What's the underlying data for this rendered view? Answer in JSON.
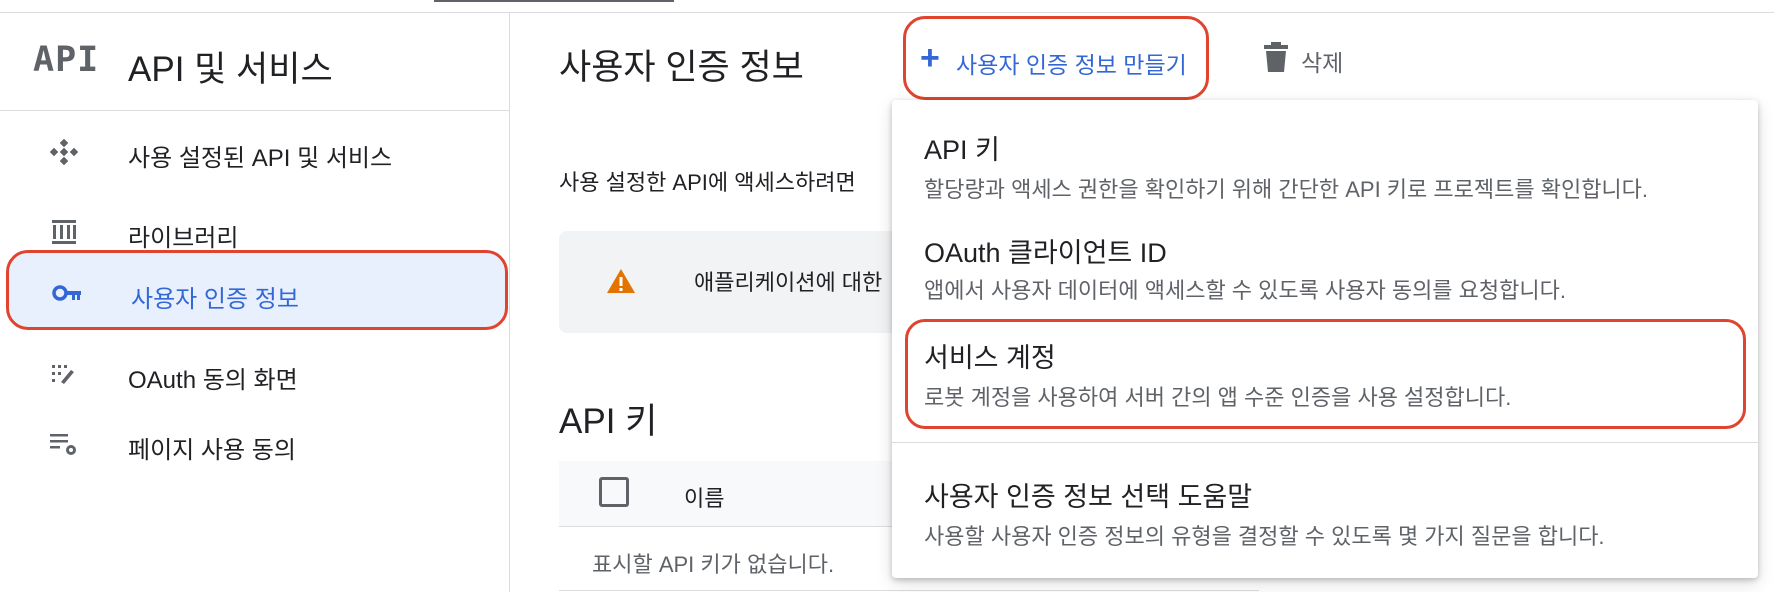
{
  "sidebar": {
    "logo": "API",
    "title": "API 및 서비스",
    "items": [
      {
        "label": "사용 설정된 API 및 서비스",
        "icon": "api-diamond-icon"
      },
      {
        "label": "라이브러리",
        "icon": "library-icon"
      },
      {
        "label": "사용자 인증 정보",
        "icon": "key-icon",
        "active": true
      },
      {
        "label": "OAuth 동의 화면",
        "icon": "consent-screen-icon"
      },
      {
        "label": "페이지 사용 동의",
        "icon": "page-settings-icon"
      }
    ]
  },
  "header": {
    "title": "사용자 인증 정보",
    "create_label": "사용자 인증 정보 만들기",
    "delete_label": "삭제"
  },
  "main": {
    "intro": "사용 설정한 API에 액세스하려면",
    "warning": "애플리케이션에 대한",
    "section_title": "API 키",
    "table": {
      "column_name": "이름",
      "empty": "표시할 API 키가 없습니다."
    }
  },
  "menu": {
    "items": [
      {
        "title": "API 키",
        "desc": "할당량과 액세스 권한을 확인하기 위해 간단한 API 키로 프로젝트를 확인합니다."
      },
      {
        "title": "OAuth 클라이언트 ID",
        "desc": "앱에서 사용자 데이터에 액세스할 수 있도록 사용자 동의를 요청합니다."
      },
      {
        "title": "서비스 계정",
        "desc": "로봇 계정을 사용하여 서버 간의 앱 수준 인증을 사용 설정합니다."
      },
      {
        "title": "사용자 인증 정보 선택 도움말",
        "desc": "사용할 사용자 인증 정보의 유형을 결정할 수 있도록 몇 가지 질문을 합니다."
      }
    ]
  },
  "colors": {
    "accent": "#3367d6",
    "highlight": "#e0432e",
    "active_bg": "#e8f0fe",
    "warning": "#e37400"
  }
}
